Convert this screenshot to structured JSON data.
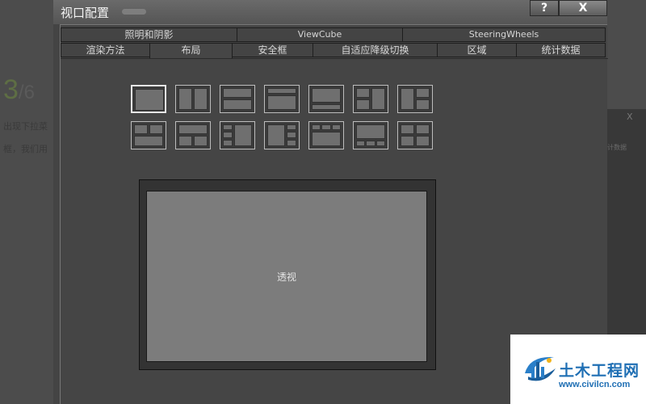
{
  "background": {
    "step_current": "3",
    "step_total": "/6",
    "line1": "出现下拉菜",
    "line2": "框，我们用",
    "side_close": "X",
    "side_text": "计数据"
  },
  "dialog": {
    "title": "视口配置",
    "help_label": "?",
    "close_label": "X"
  },
  "tabs": {
    "row1": [
      "照明和阴影",
      "ViewCube",
      "SteeringWheels"
    ],
    "row2": [
      "渲染方法",
      "布局",
      "安全框",
      "自适应降级切换",
      "区域",
      "统计数据"
    ],
    "active": "布局"
  },
  "layout": {
    "selected_index": 0,
    "presets_count": 14
  },
  "preview": {
    "viewport_label": "透视"
  },
  "watermark": {
    "name": "土木工程网",
    "url": "www.civilcn.com"
  },
  "colors": {
    "dialog_bg": "#444444",
    "viewport": "#7c7c7c",
    "watermark_blue": "#1f6fb4"
  }
}
